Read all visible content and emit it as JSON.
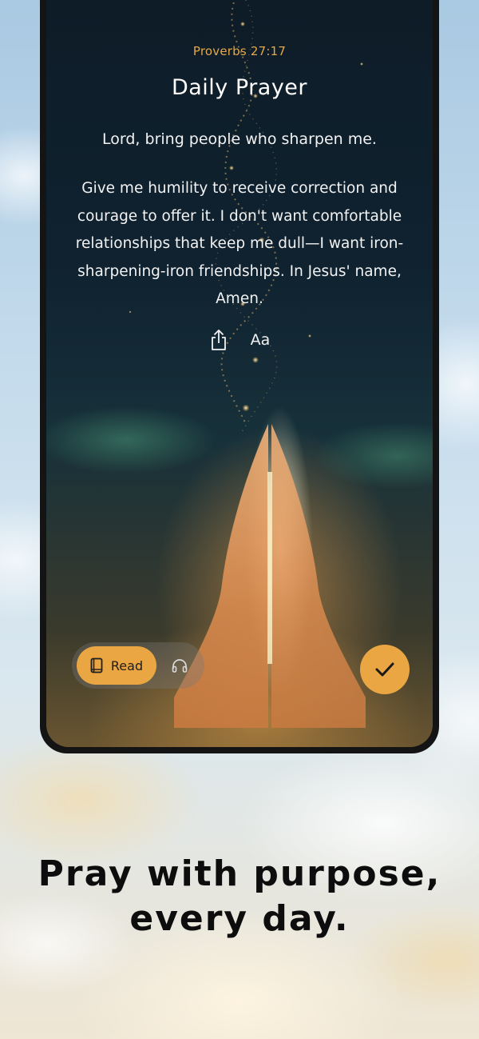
{
  "card": {
    "verse_reference": "Proverbs 27:17",
    "title": "Daily Prayer",
    "lead": "Lord, bring people who sharpen me.",
    "body": "Give me humility to receive correction and courage to offer it. I don't want comfortable relationships that keep me dull—I want iron-sharpening-iron friendships. In Jesus' name, Amen.",
    "font_size_label": "Aa"
  },
  "controls": {
    "read_label": "Read",
    "icons": {
      "share": "share-icon",
      "read": "book-icon",
      "listen": "headphones-icon",
      "done": "checkmark-icon"
    }
  },
  "tagline": {
    "line1": "Pray with purpose,",
    "line2": "every day."
  },
  "colors": {
    "accent": "#e9a642",
    "reference": "#e3a84a",
    "frame": "#141414"
  }
}
